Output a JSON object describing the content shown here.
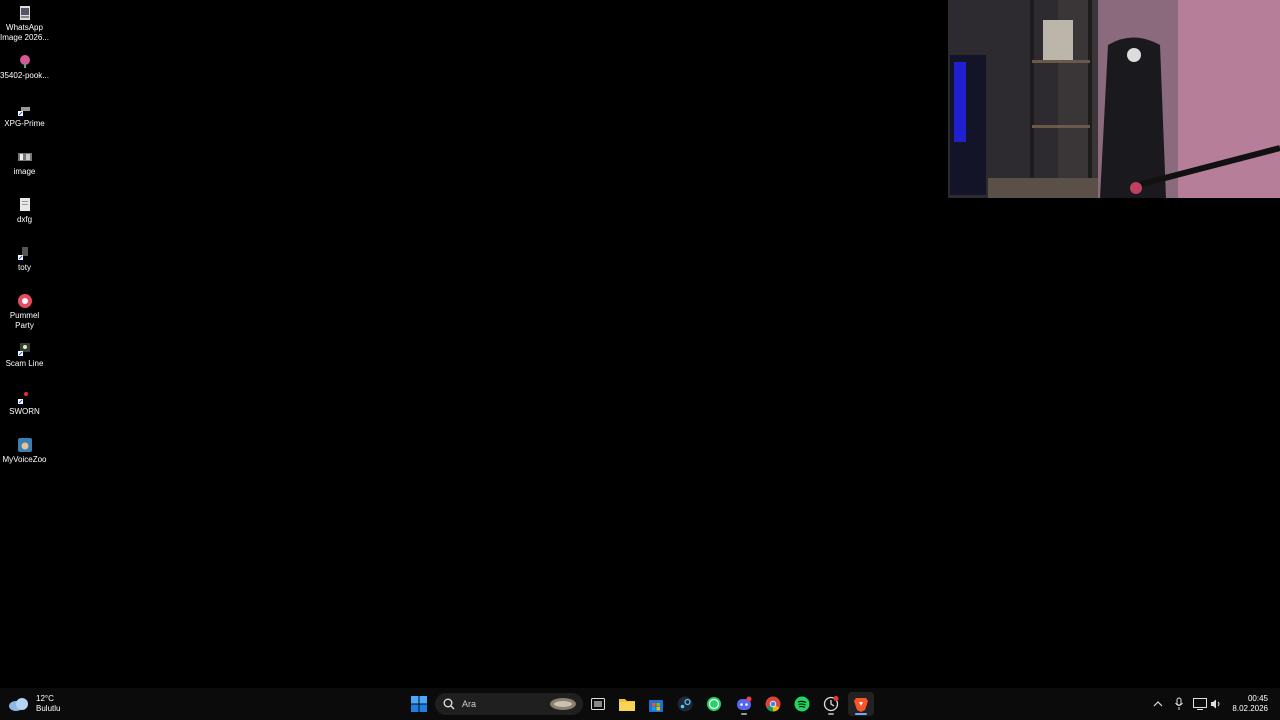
{
  "desktop": {
    "icons": [
      {
        "label": "WhatsApp Image 2026...",
        "icon": "image-file-icon"
      },
      {
        "label": "35402-pook...",
        "icon": "flower-image-icon"
      },
      {
        "label": "XPG-Prime",
        "icon": "shortcut-icon"
      },
      {
        "label": "image",
        "icon": "image-file-icon"
      },
      {
        "label": "dxfg",
        "icon": "document-icon"
      },
      {
        "label": "toty",
        "icon": "shortcut-icon"
      },
      {
        "label": "Pummel Party",
        "icon": "game-icon"
      },
      {
        "label": "Scam Line",
        "icon": "game-icon"
      },
      {
        "label": "SWORN",
        "icon": "game-icon"
      },
      {
        "label": "MyVoiceZoo",
        "icon": "app-icon"
      }
    ]
  },
  "webcam": {
    "icon": "webcam-overlay"
  },
  "taskbar": {
    "weather": {
      "temp": "12°C",
      "condition": "Bulutlu",
      "icon": "cloud-icon"
    },
    "search": {
      "placeholder": "Ara",
      "icon": "search-icon"
    },
    "apps": [
      {
        "name": "start",
        "icon": "windows-start-icon"
      },
      {
        "name": "task-view",
        "icon": "task-view-icon"
      },
      {
        "name": "file-explorer",
        "icon": "folder-icon"
      },
      {
        "name": "microsoft-store",
        "icon": "store-icon"
      },
      {
        "name": "steam",
        "icon": "steam-icon"
      },
      {
        "name": "whatsapp",
        "icon": "whatsapp-icon"
      },
      {
        "name": "discord",
        "icon": "discord-icon"
      },
      {
        "name": "chrome",
        "icon": "chrome-icon"
      },
      {
        "name": "spotify",
        "icon": "spotify-icon"
      },
      {
        "name": "app",
        "icon": "app-icon"
      },
      {
        "name": "brave",
        "icon": "brave-icon"
      }
    ],
    "tray": {
      "icons": [
        "chevron-up-icon",
        "microphone-icon",
        "display-icon",
        "volume-icon"
      ]
    },
    "clock": {
      "time": "00:45",
      "date": "8.02.2026"
    }
  },
  "colors": {
    "desktop_bg": "#000000",
    "taskbar_bg": "#0b0b0b",
    "accent": "#0a84ff"
  }
}
